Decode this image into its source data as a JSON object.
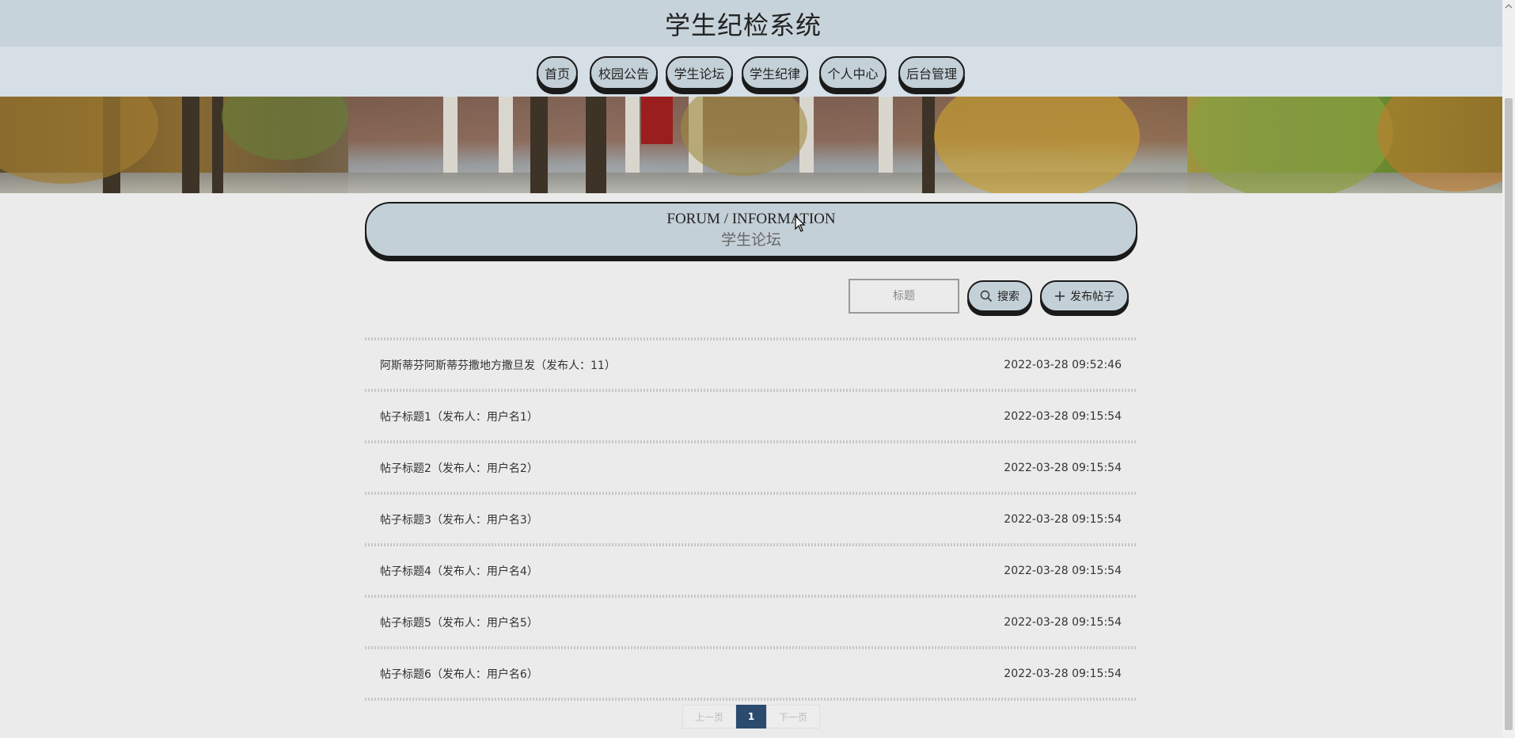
{
  "header": {
    "title": "学生纪检系统"
  },
  "nav": {
    "items": [
      {
        "label": "首页"
      },
      {
        "label": "校园公告"
      },
      {
        "label": "学生论坛"
      },
      {
        "label": "学生纪律"
      },
      {
        "label": "个人中心"
      },
      {
        "label": "后台管理"
      }
    ]
  },
  "forum": {
    "heading_en": "FORUM / INFORMATION",
    "heading_cn": "学生论坛"
  },
  "search": {
    "placeholder": "标题",
    "button_label": "搜索",
    "publish_label": "发布帖子"
  },
  "posts": [
    {
      "title": "阿斯蒂芬阿斯蒂芬撒地方撒旦发（发布人：11）",
      "time": "2022-03-28 09:52:46"
    },
    {
      "title": "帖子标题1（发布人：用户名1）",
      "time": "2022-03-28 09:15:54"
    },
    {
      "title": "帖子标题2（发布人：用户名2）",
      "time": "2022-03-28 09:15:54"
    },
    {
      "title": "帖子标题3（发布人：用户名3）",
      "time": "2022-03-28 09:15:54"
    },
    {
      "title": "帖子标题4（发布人：用户名4）",
      "time": "2022-03-28 09:15:54"
    },
    {
      "title": "帖子标题5（发布人：用户名5）",
      "time": "2022-03-28 09:15:54"
    },
    {
      "title": "帖子标题6（发布人：用户名6）",
      "time": "2022-03-28 09:15:54"
    }
  ],
  "pagination": {
    "prev_label": "上一页",
    "current": "1",
    "next_label": "下一页"
  },
  "colors": {
    "accent": "#c4d0d8",
    "header_bg": "#c7d3da",
    "page_bg": "#ebebeb",
    "pager_active": "#2a4a6e"
  }
}
